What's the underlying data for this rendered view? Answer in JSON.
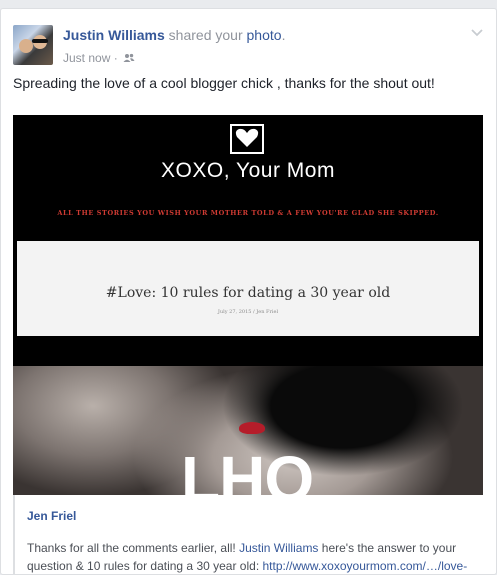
{
  "post": {
    "author_name": "Justin Williams",
    "action_text": " shared your ",
    "action_link": "photo",
    "action_end": ".",
    "timestamp": "Just now",
    "separator": " · ",
    "caption": "Spreading the love of a cool blogger chick , thanks for the shout out!"
  },
  "shared_image": {
    "site_title": "XOXO, Your Mom",
    "tagline": "ALL THE STORIES YOU WISH YOUR MOTHER TOLD & A FEW YOU'RE GLAD SHE SKIPPED.",
    "post_title": "#Love: 10 rules for dating a 30 year old",
    "post_byline": "July 27, 2015 / Jen Friel",
    "overlay_text": "LHQ"
  },
  "preview": {
    "author": "Jen Friel",
    "text_start": "Thanks for all the comments earlier, all! ",
    "mention": "Justin Williams",
    "text_mid": " here's the answer to your question & 10 rules for dating a 30 year old: ",
    "url": "http://www.xoxoyourmom.com/…/love-"
  },
  "colors": {
    "link": "#365899",
    "tagline_red": "#d13b33",
    "text": "#1d2129",
    "meta": "#90949c"
  },
  "icons": {
    "audience": "friends-icon",
    "menu": "chevron-down-icon",
    "logo": "heart-logo-icon"
  }
}
